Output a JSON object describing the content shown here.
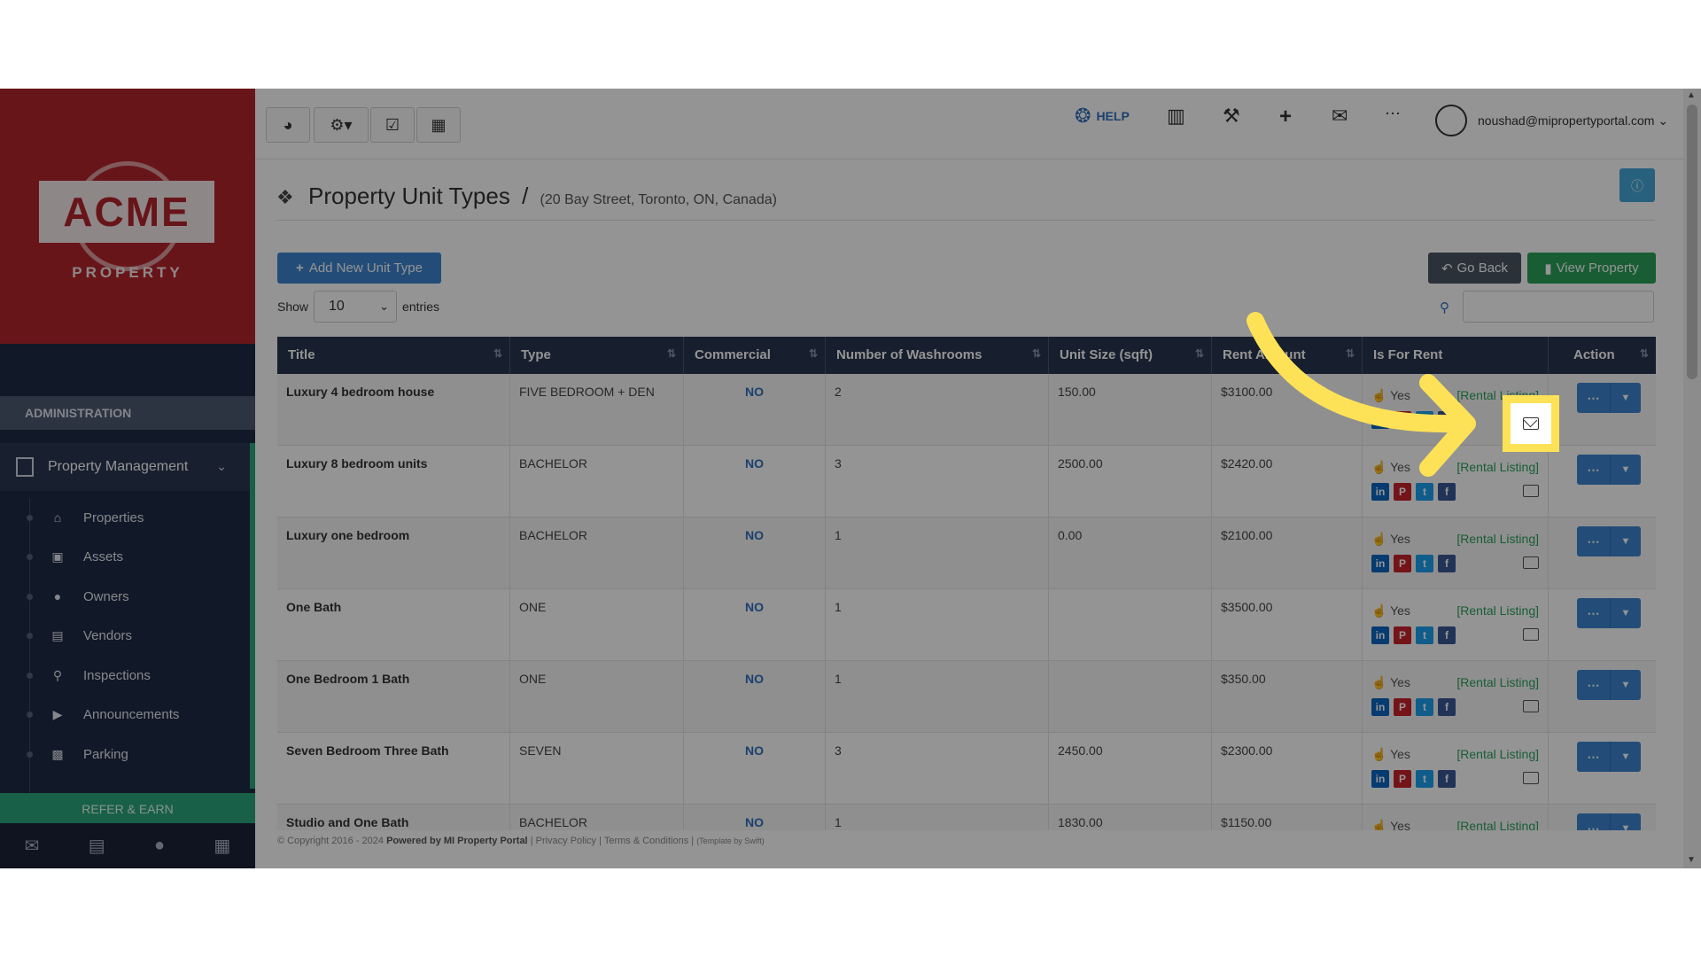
{
  "sidebar": {
    "logo_text": "ACME",
    "logo_sub": "PROPERTY",
    "section_label": "ADMINISTRATION",
    "menu_label": "Property Management",
    "items": [
      {
        "label": "Properties",
        "icon": "home-icon"
      },
      {
        "label": "Assets",
        "icon": "assets-icon"
      },
      {
        "label": "Owners",
        "icon": "user-icon"
      },
      {
        "label": "Vendors",
        "icon": "briefcase-icon"
      },
      {
        "label": "Inspections",
        "icon": "search-icon"
      },
      {
        "label": "Announcements",
        "icon": "bullhorn-icon"
      },
      {
        "label": "Parking",
        "icon": "car-icon"
      }
    ],
    "refer_label": "REFER & EARN"
  },
  "topbar": {
    "help_label": "HELP",
    "user_email": "noushad@mipropertyportal.com"
  },
  "page": {
    "title": "Property Unit Types",
    "separator": "/",
    "address": "(20 Bay Street, Toronto, ON, Canada)",
    "add_button": "Add New Unit Type",
    "back_button": "Go Back",
    "view_button": "View Property",
    "show_label": "Show",
    "entries_value": "10",
    "entries_label": "entries"
  },
  "table": {
    "headers": [
      "Title",
      "Type",
      "Commercial",
      "Number of Washrooms",
      "Unit Size (sqft)",
      "Rent Amount",
      "Is For Rent",
      "Action"
    ],
    "rent_yes": "Yes",
    "rent_listing": "[Rental Listing]",
    "rows": [
      {
        "title": "Luxury 4 bedroom house",
        "type": "FIVE BEDROOM + DEN",
        "commercial": "NO",
        "washrooms": "2",
        "size": "150.00",
        "rent": "$3100.00"
      },
      {
        "title": "Luxury 8 bedroom units",
        "type": "BACHELOR",
        "commercial": "NO",
        "washrooms": "3",
        "size": "2500.00",
        "rent": "$2420.00"
      },
      {
        "title": "Luxury one bedroom",
        "type": "BACHELOR",
        "commercial": "NO",
        "washrooms": "1",
        "size": "0.00",
        "rent": "$2100.00"
      },
      {
        "title": "One Bath",
        "type": "ONE",
        "commercial": "NO",
        "washrooms": "1",
        "size": "",
        "rent": "$3500.00"
      },
      {
        "title": "One Bedroom 1 Bath",
        "type": "ONE",
        "commercial": "NO",
        "washrooms": "1",
        "size": "",
        "rent": "$350.00"
      },
      {
        "title": "Seven Bedroom Three Bath",
        "type": "SEVEN",
        "commercial": "NO",
        "washrooms": "3",
        "size": "2450.00",
        "rent": "$2300.00"
      },
      {
        "title": "Studio and One Bath",
        "type": "BACHELOR",
        "commercial": "NO",
        "washrooms": "1",
        "size": "1830.00",
        "rent": "$1150.00"
      }
    ]
  },
  "footer": {
    "copyright": "© Copyright 2016 - 2024",
    "powered": "Powered by MI Property Portal",
    "links": "| Privacy Policy | Terms & Conditions |",
    "small": "(Template by Swift)"
  },
  "colors": {
    "brand_red": "#b3252c",
    "nav_dark": "#1e2a44",
    "accent_green": "#2aa57a",
    "primary_blue": "#3d86cf",
    "highlight_yellow": "#fde257"
  }
}
